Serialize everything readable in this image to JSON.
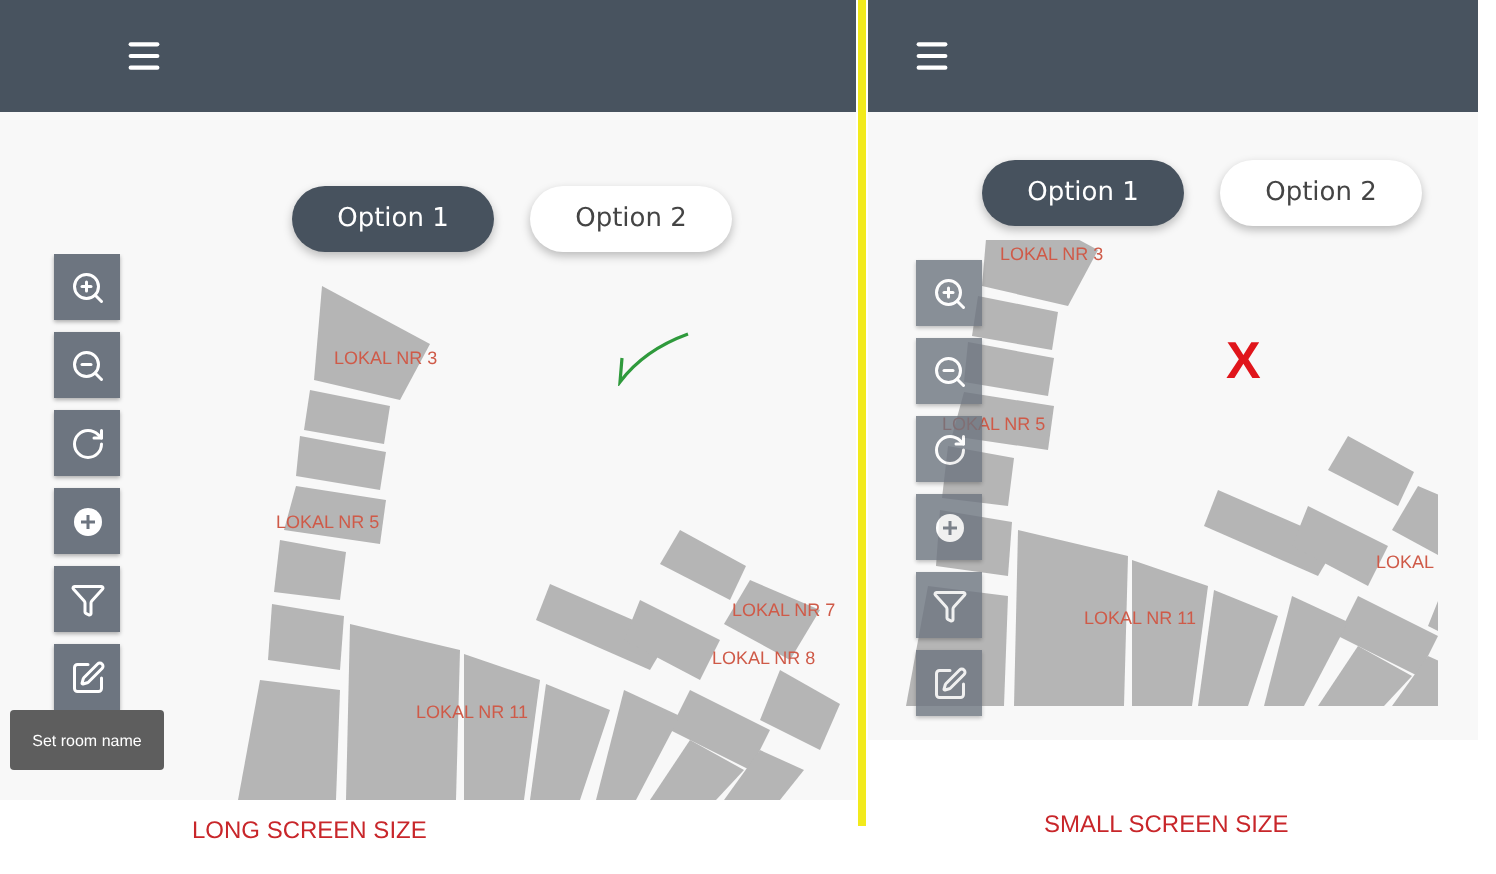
{
  "screens": [
    {
      "options": [
        {
          "label": "Option 1",
          "selected": true
        },
        {
          "label": "Option 2",
          "selected": false
        }
      ],
      "room_labels": [
        "LOKAL NR 3",
        "LOKAL NR 5",
        "LOKAL NR 7",
        "LOKAL NR 8",
        "LOKAL NR 11"
      ],
      "tooltip": "Set room name",
      "verdict": {
        "kind": "check"
      },
      "caption": "LONG SCREEN SIZE"
    },
    {
      "options": [
        {
          "label": "Option 1",
          "selected": true
        },
        {
          "label": "Option 2",
          "selected": false
        }
      ],
      "room_labels": [
        "LOKAL NR 3",
        "LOKAL NR 5",
        "LOKAL NR 11",
        "LOKAL"
      ],
      "verdict": {
        "kind": "text",
        "text": "X"
      },
      "caption": "SMALL SCREEN SIZE"
    }
  ]
}
